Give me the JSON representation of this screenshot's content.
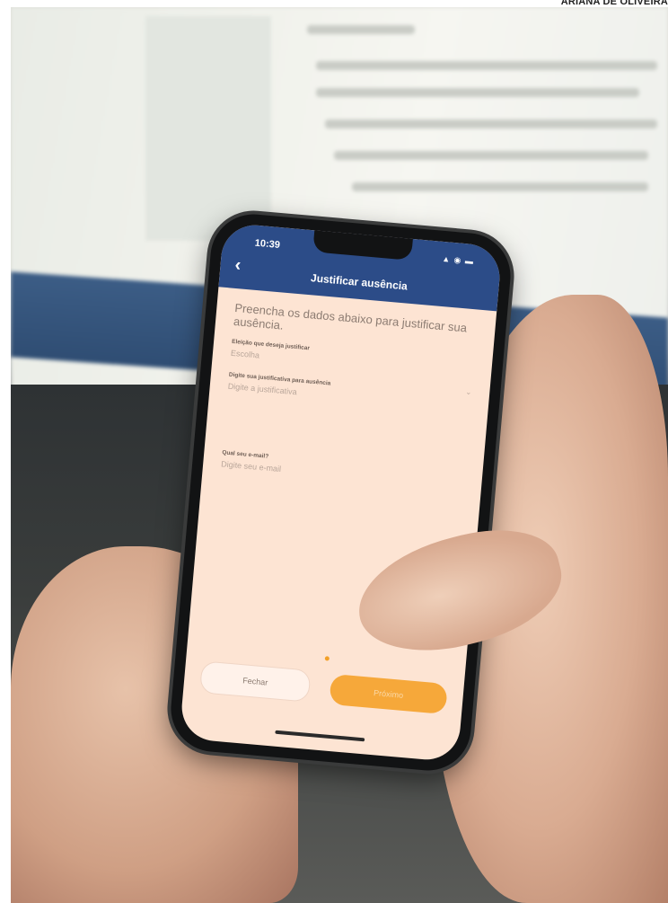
{
  "photo_credit": "ARIANA DE OLIVEIRA",
  "phone": {
    "status": {
      "time": "10:39",
      "icons": "▲ ◉ ▬"
    },
    "header": {
      "title": "Justificar ausência",
      "back_icon": "‹"
    },
    "intro": "Preencha os dados abaixo para justificar sua ausência.",
    "fields": [
      {
        "label": "Eleição que deseja justificar",
        "placeholder": "Escolha"
      },
      {
        "label": "Digite sua justificativa para ausência",
        "placeholder": "Digite a justificativa"
      },
      {
        "label": "Qual seu e-mail?",
        "placeholder": "Digite seu e-mail"
      }
    ],
    "buttons": {
      "close": "Fechar",
      "next": "Próximo"
    }
  },
  "colors": {
    "header": "#2c4c88",
    "screen": "#fde4d3",
    "accent": "#f6a83a"
  }
}
